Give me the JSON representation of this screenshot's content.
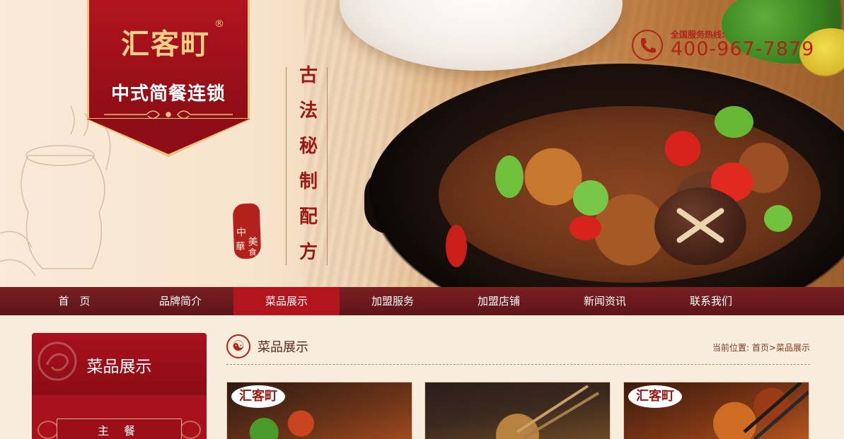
{
  "brand": {
    "logo_text": "汇客町",
    "logo_registered": "®",
    "tagline": "中式简餐连锁"
  },
  "hero": {
    "calligraphy": [
      "古",
      "法",
      "秘",
      "制",
      "配",
      "方"
    ],
    "seal_chars": [
      "中",
      "華",
      "美",
      "食"
    ],
    "hotline_label": "全国服务热线:",
    "hotline_number": "400-967-7879"
  },
  "nav": {
    "items": [
      {
        "label": "首　页"
      },
      {
        "label": "品牌简介"
      },
      {
        "label": "菜品展示"
      },
      {
        "label": "加盟服务"
      },
      {
        "label": "加盟店铺"
      },
      {
        "label": "新闻资讯"
      },
      {
        "label": "联系我们"
      }
    ],
    "active_index": 2
  },
  "sidebar": {
    "title": "菜品展示",
    "first_category": "主 餐"
  },
  "section": {
    "title": "菜品展示",
    "breadcrumb_prefix": "当前位置:",
    "breadcrumb_home": "首页",
    "breadcrumb_sep": ">",
    "breadcrumb_current": "菜品展示"
  },
  "thumbnails": [
    {
      "badge": "汇客町"
    },
    {
      "badge": ""
    },
    {
      "badge": "汇客町"
    }
  ],
  "colors": {
    "brand_red": "#a8111c",
    "nav_bg": "#6b1a1d",
    "accent_red": "#b02418",
    "gold": "#e9c27b"
  },
  "icons": [
    "phone-icon",
    "dragon-emblem-icon",
    "section-emblem-icon"
  ]
}
